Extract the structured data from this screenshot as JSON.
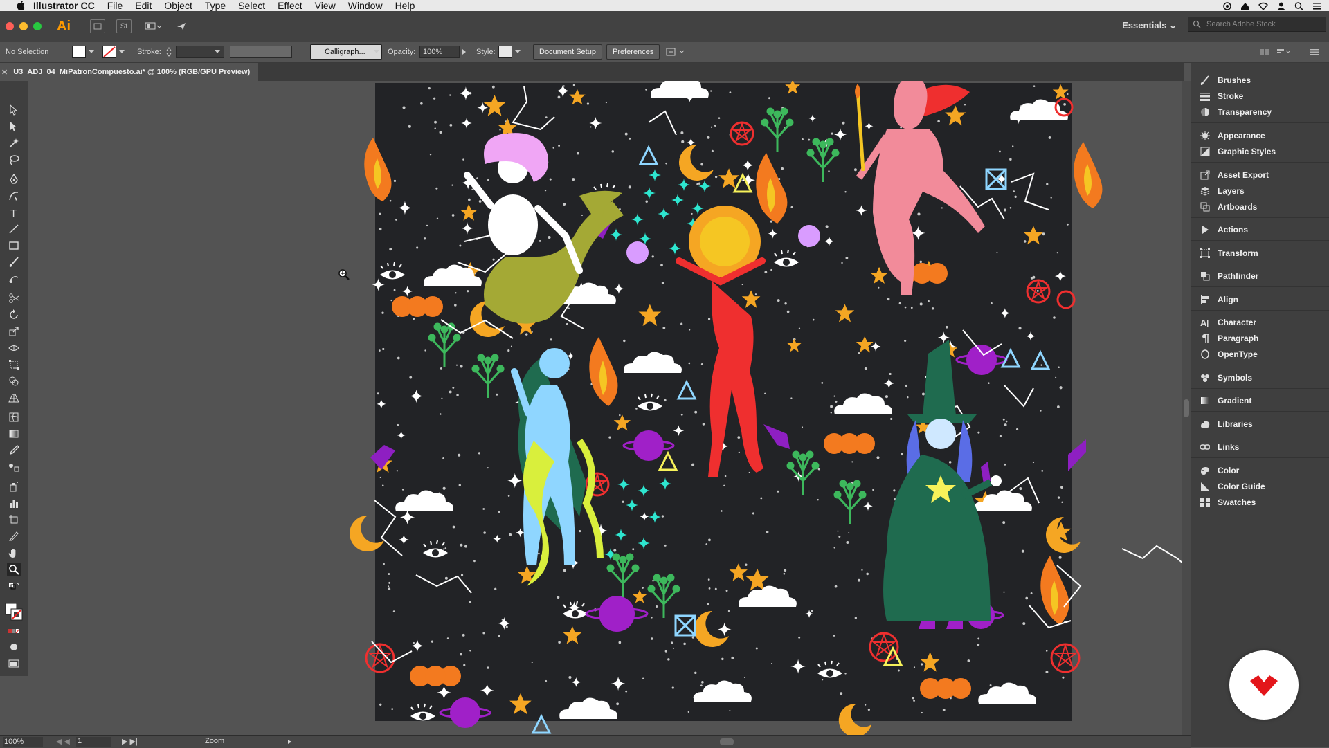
{
  "menubar": {
    "app_name": "Illustrator CC",
    "items": [
      "File",
      "Edit",
      "Object",
      "Type",
      "Select",
      "Effect",
      "View",
      "Window",
      "Help"
    ]
  },
  "appbar": {
    "logo": "Ai",
    "st_label": "St",
    "workspace": "Essentials",
    "stock_search_placeholder": "Search Adobe Stock"
  },
  "controlbar": {
    "selection_label": "No Selection",
    "stroke_label": "Stroke:",
    "brush_label": "Calligraph...",
    "opacity_label": "Opacity:",
    "opacity_value": "100%",
    "style_label": "Style:",
    "document_setup": "Document Setup",
    "preferences": "Preferences"
  },
  "document": {
    "tab_title": "U3_ADJ_04_MiPatronCompuesto.ai* @ 100% (RGB/GPU Preview)"
  },
  "statusbar": {
    "zoom": "100%",
    "page": "1",
    "tool_name": "Zoom"
  },
  "panels": [
    {
      "label": "Brushes",
      "icon": "brush-icon"
    },
    {
      "label": "Stroke",
      "icon": "stroke-icon"
    },
    {
      "label": "Transparency",
      "icon": "transparency-icon"
    },
    {
      "label": "Appearance",
      "icon": "appearance-icon"
    },
    {
      "label": "Graphic Styles",
      "icon": "graphic-styles-icon"
    },
    {
      "label": "Asset Export",
      "icon": "asset-export-icon"
    },
    {
      "label": "Layers",
      "icon": "layers-icon"
    },
    {
      "label": "Artboards",
      "icon": "artboards-icon"
    },
    {
      "label": "Actions",
      "icon": "play-icon"
    },
    {
      "label": "Transform",
      "icon": "transform-icon"
    },
    {
      "label": "Pathfinder",
      "icon": "pathfinder-icon"
    },
    {
      "label": "Align",
      "icon": "align-icon"
    },
    {
      "label": "Character",
      "icon": "character-icon"
    },
    {
      "label": "Paragraph",
      "icon": "paragraph-icon"
    },
    {
      "label": "OpenType",
      "icon": "opentype-icon"
    },
    {
      "label": "Symbols",
      "icon": "symbols-icon"
    },
    {
      "label": "Gradient",
      "icon": "gradient-icon"
    },
    {
      "label": "Libraries",
      "icon": "libraries-icon"
    },
    {
      "label": "Links",
      "icon": "links-icon"
    },
    {
      "label": "Color",
      "icon": "color-icon"
    },
    {
      "label": "Color Guide",
      "icon": "color-guide-icon"
    },
    {
      "label": "Swatches",
      "icon": "swatches-icon"
    }
  ],
  "colors": {
    "ui_dark": "#3f3f3f",
    "canvas": "#535353",
    "artboard": "#222326",
    "accent_orange": "#ff9a00",
    "pattern_red": "#ef2f2f",
    "pattern_orange": "#f5a623",
    "pattern_purple": "#a020c8",
    "pattern_teal": "#2ee6d0"
  }
}
